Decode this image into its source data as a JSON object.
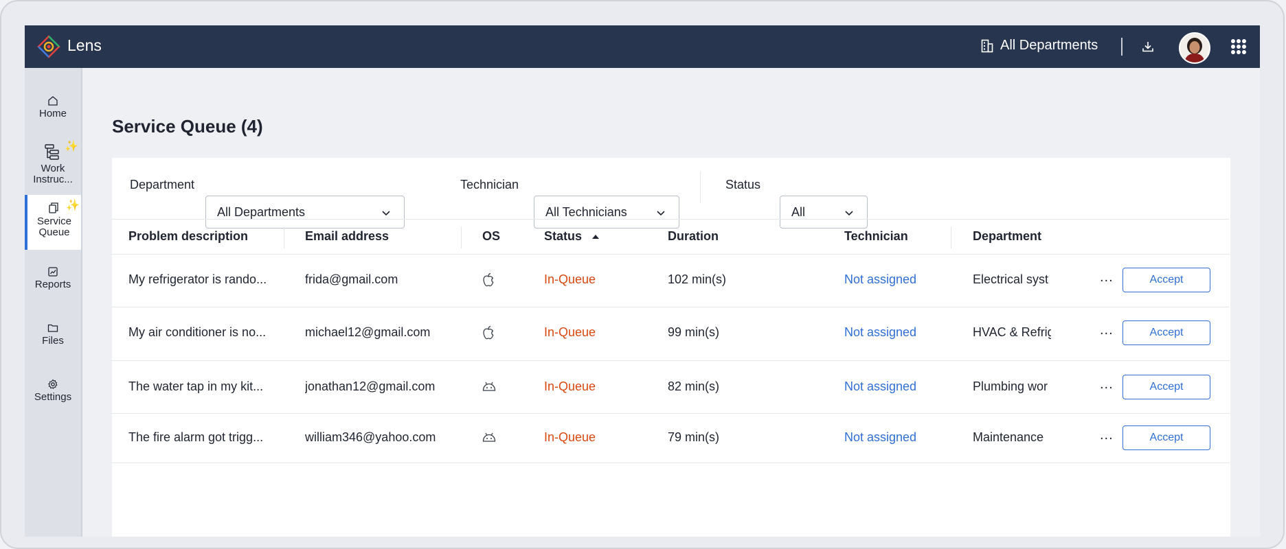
{
  "app": {
    "name": "Lens"
  },
  "header": {
    "department_selector": "All Departments",
    "download_icon": "download-icon",
    "avatar_icon": "avatar",
    "apps_icon": "grid-icon"
  },
  "sidebar": {
    "items": [
      {
        "label": "Home",
        "icon": "home-icon"
      },
      {
        "label": "Work Instruc...",
        "line1": "Work",
        "line2": "Instruc...",
        "icon": "work-instructions-icon"
      },
      {
        "label": "Service Queue",
        "line1": "Service",
        "line2": "Queue",
        "icon": "service-queue-icon",
        "active": true
      },
      {
        "label": "Reports",
        "icon": "reports-icon"
      },
      {
        "label": "Files",
        "icon": "folder-icon"
      },
      {
        "label": "Settings",
        "icon": "gear-icon"
      }
    ]
  },
  "page": {
    "title": "Service Queue (4)"
  },
  "filters": {
    "department_label": "Department",
    "department_value": "All Departments",
    "technician_label": "Technician",
    "technician_value": "All Technicians",
    "status_label": "Status",
    "status_value": "All"
  },
  "table": {
    "columns": [
      "Problem description",
      "Email address",
      "OS",
      "Status",
      "Duration",
      "Technician",
      "Department"
    ],
    "sorted_column": "Status",
    "sort_direction": "ascending",
    "rows": [
      {
        "problem": "My refrigerator is rando...",
        "email": "frida@gmail.com",
        "os": "apple",
        "status": "In-Queue",
        "duration": "102 min(s)",
        "technician": "Not assigned",
        "department": "Electrical syst",
        "more": "...",
        "action": "Accept"
      },
      {
        "problem": "My air conditioner is no...",
        "email": "michael12@gmail.com",
        "os": "apple",
        "status": "In-Queue",
        "duration": "99 min(s)",
        "technician": "Not assigned",
        "department": "HVAC & Refrig",
        "more": "...",
        "action": "Accept"
      },
      {
        "problem": "The water tap in my kit...",
        "email": "jonathan12@gmail.com",
        "os": "android",
        "status": "In-Queue",
        "duration": "82 min(s)",
        "technician": "Not assigned",
        "department": "Plumbing wor",
        "more": "...",
        "action": "Accept"
      },
      {
        "problem": "The fire alarm got trigg...",
        "email": "william346@yahoo.com",
        "os": "android",
        "status": "In-Queue",
        "duration": "79 min(s)",
        "technician": "Not assigned",
        "department": "Maintenance",
        "more": "...",
        "action": "Accept"
      }
    ]
  },
  "colors": {
    "topbar": "#28354f",
    "accent": "#2f6fd6",
    "status_in_queue": "#d9480f",
    "sparkle": "#f5b400"
  }
}
